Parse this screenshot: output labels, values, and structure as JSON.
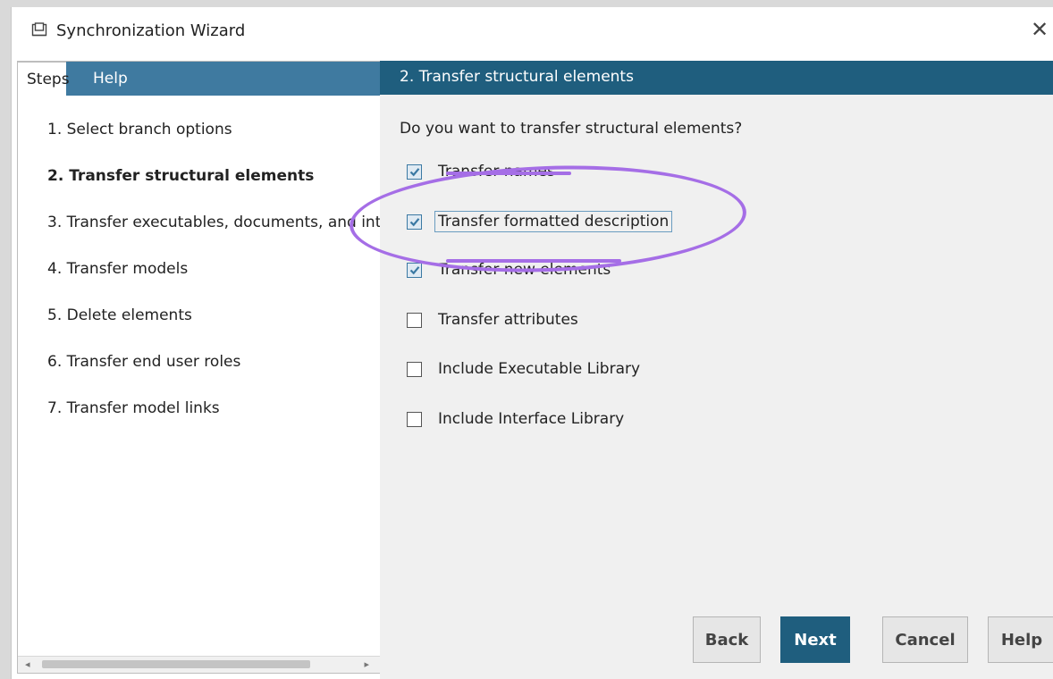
{
  "window": {
    "title": "Synchronization Wizard",
    "close_symbol": "✕"
  },
  "left": {
    "tabs": [
      {
        "label": "Steps",
        "active": true
      },
      {
        "label": "Help",
        "active": false
      }
    ],
    "steps": [
      "1. Select branch options",
      "2. Transfer structural elements",
      "3. Transfer executables, documents, and int",
      "4. Transfer models",
      "5. Delete elements",
      "6. Transfer end user roles",
      "7. Transfer model links"
    ],
    "current_step_index": 1
  },
  "right": {
    "header": "2. Transfer structural elements",
    "question": "Do you want to transfer structural elements?",
    "options": [
      {
        "label": "Transfer names",
        "checked": true
      },
      {
        "label": "Transfer formatted description",
        "checked": true
      },
      {
        "label": "Transfer new elements",
        "checked": true
      },
      {
        "label": "Transfer attributes",
        "checked": false
      },
      {
        "label": "Include Executable Library",
        "checked": false
      },
      {
        "label": "Include Interface Library",
        "checked": false
      }
    ]
  },
  "buttons": {
    "back": "Back",
    "next": "Next",
    "cancel": "Cancel",
    "help": "Help"
  },
  "colors": {
    "header_blue": "#1f5e7e",
    "tab_strip_blue": "#3f7aa0",
    "annotation_purple": "#a56ee6"
  },
  "icons": {
    "title": "wizard-window-icon",
    "close": "close-icon",
    "check": "checkmark-icon",
    "scroll_left": "scroll-left-arrow-icon",
    "scroll_right": "scroll-right-arrow-icon"
  }
}
